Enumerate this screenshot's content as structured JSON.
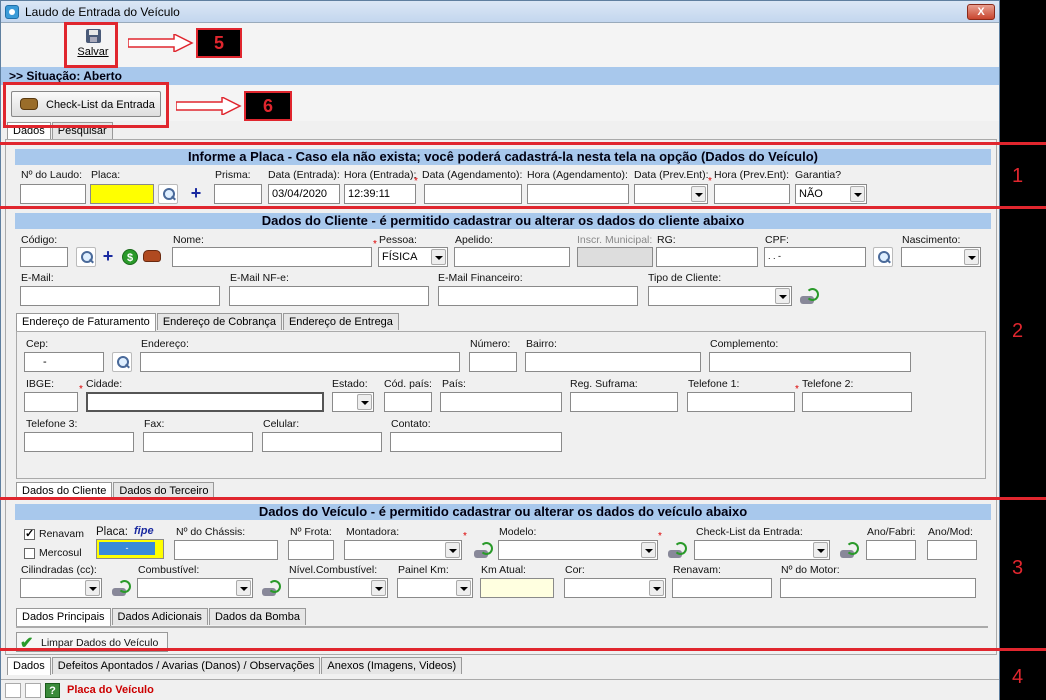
{
  "window": {
    "title": "Laudo de Entrada do Veículo",
    "close_label": "X"
  },
  "toolbar": {
    "save_label": "Salvar"
  },
  "status_bar_top": "Situação: Aberto",
  "checklist_button": "Check-List da Entrada",
  "top_tabs": [
    "Dados",
    "Pesquisar"
  ],
  "placa_section": {
    "header": "Informe a Placa - Caso ela não exista; você poderá cadastrá-la nesta tela na opção (Dados do Veículo)",
    "labels": {
      "laudo": "Nº do Laudo:",
      "placa": "Placa:",
      "prisma": "Prisma:",
      "data_entrada": "Data (Entrada):",
      "hora_entrada": "Hora (Entrada):",
      "data_agend": "Data (Agendamento):",
      "hora_agend": "Hora (Agendamento):",
      "data_prev": "Data (Prev.Ent):",
      "hora_prev": "Hora (Prev.Ent):",
      "garantia": "Garantia?"
    },
    "values": {
      "data_entrada": "03/04/2020",
      "hora_entrada": "12:39:11",
      "garantia": "NÃO"
    },
    "placa_color": "#ffff00"
  },
  "cliente_section": {
    "header": "Dados do Cliente - é permitido cadastrar ou alterar os dados do cliente abaixo",
    "labels": {
      "codigo": "Código:",
      "nome": "Nome:",
      "pessoa": "Pessoa:",
      "apelido": "Apelido:",
      "inscr": "Inscr. Municipal:",
      "rg": "RG:",
      "cpf": "CPF:",
      "nascimento": "Nascimento:",
      "email": "E-Mail:",
      "email_nfe": "E-Mail NF-e:",
      "email_fin": "E-Mail Financeiro:",
      "tipo": "Tipo de Cliente:"
    },
    "values": {
      "pessoa": "FÍSICA",
      "cpf": ". . -"
    },
    "address_tabs": [
      "Endereço de Faturamento",
      "Endereço de Cobrança",
      "Endereço de Entrega"
    ],
    "address_labels": {
      "cep": "Cep:",
      "endereco": "Endereço:",
      "numero": "Número:",
      "bairro": "Bairro:",
      "complemento": "Complemento:",
      "ibge": "IBGE:",
      "cidade": "Cidade:",
      "estado": "Estado:",
      "cod_pais": "Cód. país:",
      "pais": "País:",
      "suframa": "Reg. Suframa:",
      "tel1": "Telefone 1:",
      "tel2": "Telefone 2:",
      "tel3": "Telefone 3:",
      "fax": "Fax:",
      "celular": "Celular:",
      "contato": "Contato:"
    },
    "address_values": {
      "cep": "-"
    },
    "bottom_tabs": [
      "Dados do Cliente",
      "Dados do Terceiro"
    ]
  },
  "veiculo_section": {
    "header": "Dados do Veículo - é permitido cadastrar ou alterar os dados do veículo abaixo",
    "labels": {
      "renavam_cb": "Renavam",
      "mercosul_cb": "Mercosul",
      "placa": "Placa:",
      "fipe": "fipe",
      "chassis": "Nº do Chássis:",
      "frota": "Nº Frota:",
      "montadora": "Montadora:",
      "modelo": "Modelo:",
      "checklist": "Check-List da Entrada:",
      "ano_fab": "Ano/Fabri:",
      "ano_mod": "Ano/Mod:",
      "cilindradas": "Cilindradas (cc):",
      "combustivel": "Combustível:",
      "nivel": "Nível.Combustível:",
      "painel": "Painel Km:",
      "km_atual": "Km Atual:",
      "cor": "Cor:",
      "renavam": "Renavam:",
      "motor": "Nº do Motor:"
    },
    "values": {
      "placa": "-"
    },
    "tabs": [
      "Dados Principais",
      "Dados Adicionais",
      "Dados da Bomba"
    ],
    "clear_button": "Limpar Dados do Veículo",
    "placa_color": "#ffff00",
    "km_color": "#ffffe0"
  },
  "bottom_tabs": [
    "Dados",
    "Defeitos Apontados / Avarias (Danos) / Observações",
    "Anexos (Imagens, Videos)"
  ],
  "status_bar": {
    "help": "?",
    "text": "Placa do Veículo"
  },
  "annotations": {
    "n1": "1",
    "n2": "2",
    "n3": "3",
    "n4": "4",
    "n5": "5",
    "n6": "6"
  },
  "colors": {
    "accent": "#a8c8ec",
    "annotation": "#e0262e"
  }
}
